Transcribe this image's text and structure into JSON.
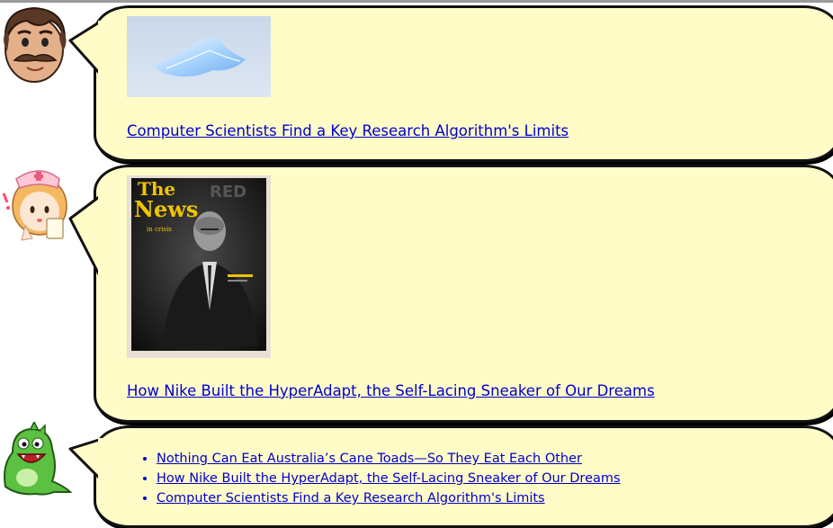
{
  "posts": [
    {
      "avatar": "mustache-man-avatar",
      "link_text": "Computer Scientists Find a Key Research Algorithm's Limits"
    },
    {
      "avatar": "nurse-avatar",
      "link_text": "How Nike Built the HyperAdapt, the Self-Lacing Sneaker of Our Dreams",
      "cover": {
        "title_line1": "The",
        "title_line2": "News",
        "subtitle": "in crisis",
        "masthead": "RED"
      }
    }
  ],
  "list_post": {
    "avatar": "green-dinosaur-avatar",
    "items": [
      "Nothing Can Eat Australia’s Cane Toads—So They Eat Each Other",
      "How Nike Built the HyperAdapt, the Self-Lacing Sneaker of Our Dreams",
      "Computer Scientists Find a Key Research Algorithm's Limits"
    ]
  },
  "colors": {
    "bubble_fill": "#fffcc8",
    "link": "#0000cc"
  }
}
